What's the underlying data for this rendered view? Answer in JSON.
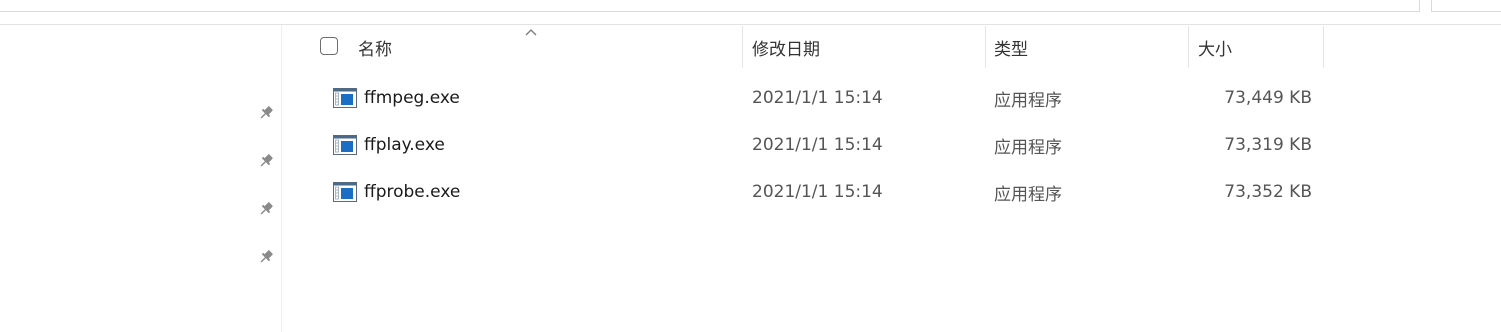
{
  "columns": {
    "name": "名称",
    "modified": "修改日期",
    "type": "类型",
    "size": "大小"
  },
  "files": [
    {
      "name": "ffmpeg.exe",
      "modified": "2021/1/1 15:14",
      "type": "应用程序",
      "size": "73,449 KB",
      "icon": "application-exe-icon"
    },
    {
      "name": "ffplay.exe",
      "modified": "2021/1/1 15:14",
      "type": "应用程序",
      "size": "73,319 KB",
      "icon": "application-exe-icon"
    },
    {
      "name": "ffprobe.exe",
      "modified": "2021/1/1 15:14",
      "type": "应用程序",
      "size": "73,352 KB",
      "icon": "application-exe-icon"
    }
  ],
  "nav_pane": {
    "pinned_icons": [
      "pin-icon",
      "pin-icon",
      "pin-icon",
      "pin-icon"
    ]
  },
  "colors": {
    "accent": "#0a64b5",
    "header_text": "#333333",
    "secondary_text": "#555555",
    "separator": "#e5e5e5"
  }
}
